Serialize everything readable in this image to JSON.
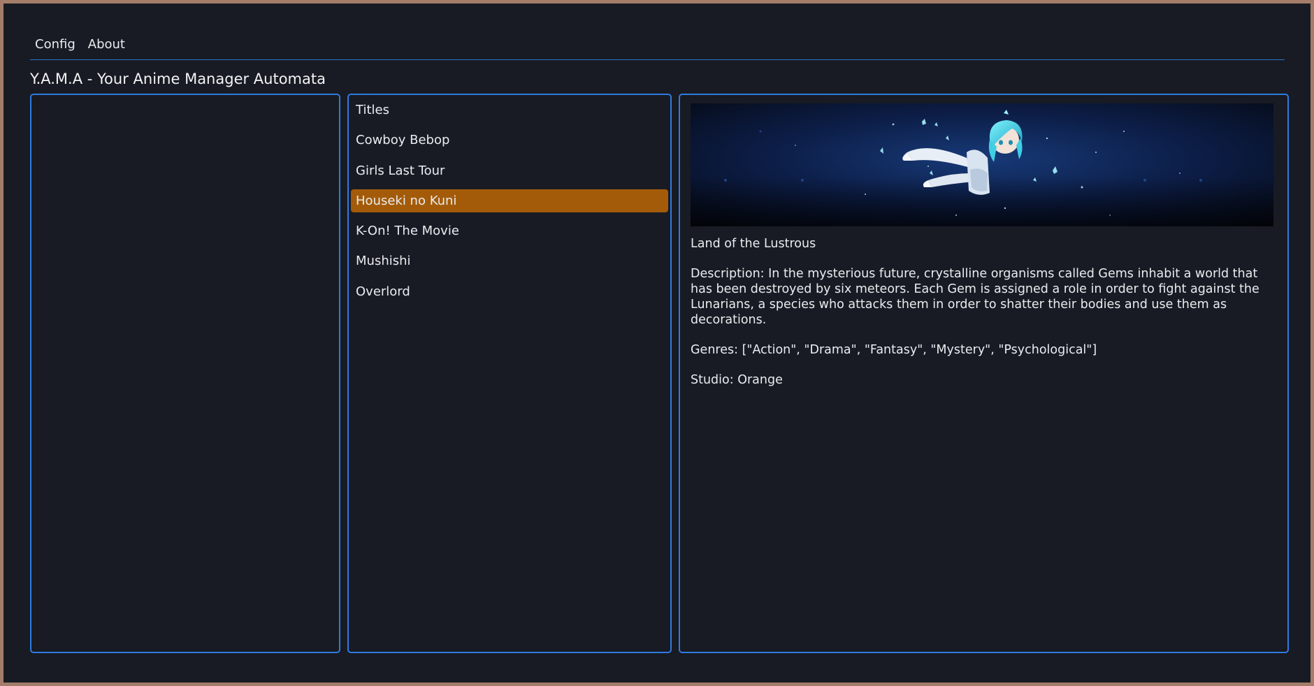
{
  "menu": [
    {
      "label": "Config"
    },
    {
      "label": "About"
    }
  ],
  "app_title": "Y.A.M.A - Your Anime Manager Automata",
  "titles_list": {
    "header": "Titles",
    "items": [
      {
        "label": "Cowboy Bebop",
        "selected": false
      },
      {
        "label": "Girls Last Tour",
        "selected": false
      },
      {
        "label": "Houseki no Kuni",
        "selected": true
      },
      {
        "label": "K-On! The Movie",
        "selected": false
      },
      {
        "label": "Mushishi",
        "selected": false
      },
      {
        "label": "Overlord",
        "selected": false
      }
    ]
  },
  "details": {
    "english_title": "Land of the Lustrous",
    "description": "Description: In the mysterious future, crystalline organisms called Gems inhabit a world that has been destroyed by six meteors. Each Gem is assigned a role in order to fight against the Lunarians, a species who attacks them in order to shatter their bodies and use them as decorations.",
    "genres": "Genres: [\"Action\", \"Drama\", \"Fantasy\", \"Mystery\", \"Psychological\"]",
    "studio": "Studio: Orange"
  },
  "colors": {
    "background": "#181b23",
    "accent_border": "#2f7be0",
    "selected": "#a45b09",
    "frame": "#a37d6a"
  }
}
